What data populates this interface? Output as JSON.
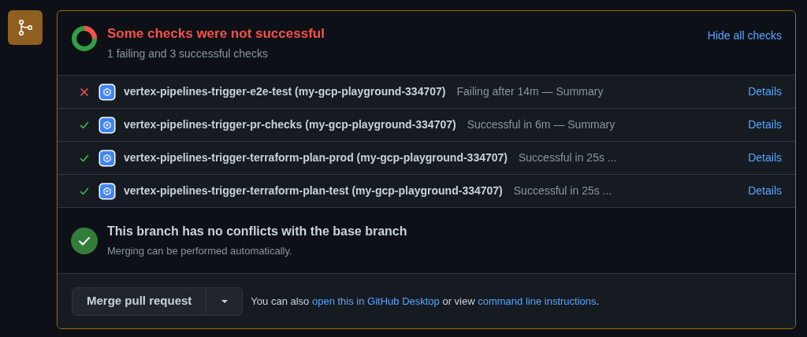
{
  "header": {
    "title": "Some checks were not successful",
    "subtitle": "1 failing and 3 successful checks",
    "toggle": "Hide all checks"
  },
  "checks": [
    {
      "kind": "failure",
      "name": "vertex-pipelines-trigger-e2e-test (my-gcp-playground-334707)",
      "description": "Failing after 14m — Summary",
      "link": "Details"
    },
    {
      "kind": "success",
      "name": "vertex-pipelines-trigger-pr-checks (my-gcp-playground-334707)",
      "description": "Successful in 6m — Summary",
      "link": "Details"
    },
    {
      "kind": "success",
      "name": "vertex-pipelines-trigger-terraform-plan-prod (my-gcp-playground-334707)",
      "description": "Successful in 25s ...",
      "link": "Details"
    },
    {
      "kind": "success",
      "name": "vertex-pipelines-trigger-terraform-plan-test (my-gcp-playground-334707)",
      "description": "Successful in 25s ...",
      "link": "Details"
    }
  ],
  "merge_status": {
    "title": "This branch has no conflicts with the base branch",
    "subtitle": "Merging can be performed automatically."
  },
  "footer": {
    "button": "Merge pull request",
    "note": [
      {
        "kind": "text",
        "text": "You can also "
      },
      {
        "kind": "link",
        "text": "open this in GitHub Desktop"
      },
      {
        "kind": "text",
        "text": " or view "
      },
      {
        "kind": "link",
        "text": "command line instructions"
      },
      {
        "kind": "text",
        "text": "."
      }
    ]
  }
}
